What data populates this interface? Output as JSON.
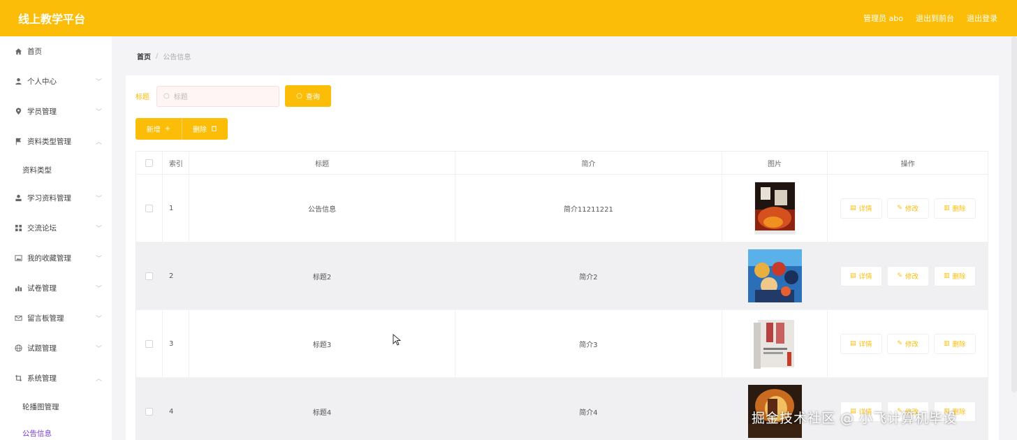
{
  "header": {
    "brand": "线上教学平台",
    "admin_label": "管理员 abo",
    "exit_to_front": "退出到前台",
    "logout": "退出登录"
  },
  "sidebar": {
    "items": [
      {
        "label": "首页",
        "icon": "home-icon",
        "expand": ""
      },
      {
        "label": "个人中心",
        "icon": "user-icon",
        "expand": "down"
      },
      {
        "label": "学员管理",
        "icon": "location-icon",
        "expand": "down"
      },
      {
        "label": "资料类型管理",
        "icon": "flag-icon",
        "expand": "up"
      },
      {
        "label": "资料类型",
        "sub": true
      },
      {
        "label": "学习资料管理",
        "icon": "person-icon",
        "expand": "down"
      },
      {
        "label": "交流论坛",
        "icon": "grid-icon",
        "expand": "down"
      },
      {
        "label": "我的收藏管理",
        "icon": "picture-icon",
        "expand": "down"
      },
      {
        "label": "试卷管理",
        "icon": "chart-icon",
        "expand": "down"
      },
      {
        "label": "留言板管理",
        "icon": "mail-icon",
        "expand": "down"
      },
      {
        "label": "试题管理",
        "icon": "globe-icon",
        "expand": "down"
      },
      {
        "label": "系统管理",
        "icon": "crop-icon",
        "expand": "up"
      },
      {
        "label": "轮播图管理",
        "sub": true
      },
      {
        "label": "公告信息",
        "sub": true,
        "active": true
      }
    ]
  },
  "breadcrumb": {
    "home": "首页",
    "separator": "/",
    "current": "公告信息"
  },
  "search": {
    "label": "标题",
    "placeholder": "标题",
    "button": "查询"
  },
  "actions": {
    "add": "新增",
    "delete": "删除"
  },
  "table": {
    "headers": {
      "index": "索引",
      "title": "标题",
      "intro": "简介",
      "image": "图片",
      "ops": "操作"
    },
    "rows": [
      {
        "index": "1",
        "title": "公告信息",
        "intro": "简介11211221"
      },
      {
        "index": "2",
        "title": "标题2",
        "intro": "简介2"
      },
      {
        "index": "3",
        "title": "标题3",
        "intro": "简介3"
      },
      {
        "index": "4",
        "title": "标题4",
        "intro": "简介4"
      }
    ],
    "op_labels": {
      "detail": "详情",
      "edit": "修改",
      "delete": "删除"
    }
  },
  "watermark": "掘金技术社区 @ 小飞计算机毕设",
  "colors": {
    "accent": "#fbbd08",
    "active_menu": "#7a3bd8"
  }
}
